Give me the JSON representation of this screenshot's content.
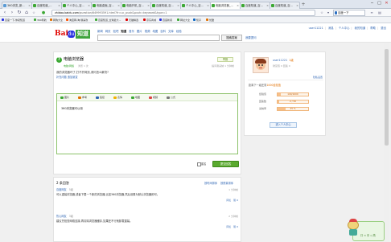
{
  "browser": {
    "tabs": [
      {
        "label": "360浏览_新...",
        "color": "#5b9bd5"
      },
      {
        "label": "百度知道_...",
        "color": "#3ca834"
      },
      {
        "label": "个人中心_百...",
        "color": "#3ca834"
      },
      {
        "label": "电脑桌面_百...",
        "color": "#3ca834"
      },
      {
        "label": "电脑开机_百...",
        "color": "#3ca834"
      },
      {
        "label": "百度知道_百...",
        "color": "#3ca834"
      },
      {
        "label": "个人中心_百...",
        "color": "#3ca834"
      },
      {
        "label": "电脑浏览器_...",
        "color": "#3ca834"
      },
      {
        "label": "百度知道_百...",
        "color": "#3ca834"
      },
      {
        "label": "百度知道_百...",
        "color": "#3ca834"
      }
    ],
    "new_tab": "+",
    "window_controls": [
      "─",
      "□",
      "✕"
    ],
    "url_host": "zhidao.baidu.com",
    "url_path": "/question/649993591.html?fr=uc_push&push=keyword&type=1",
    "search_label": "百度一下",
    "bookmarks": [
      {
        "label": "百度一下,你就知道",
        "color": "#2932e1"
      },
      {
        "label": "360导航",
        "color": "#3ca834"
      },
      {
        "label": "网购大全",
        "color": "#e17000"
      },
      {
        "label": "淘宝网-淘!我喜欢",
        "color": "#ff5000"
      },
      {
        "label": "百度知道_全球最大...",
        "color": "#3ca834"
      },
      {
        "label": "天猫精选",
        "color": "#d00"
      },
      {
        "label": "京东商城",
        "color": "#d00"
      },
      {
        "label": "百度新闻",
        "color": "#2932e1"
      },
      {
        "label": "网址大全",
        "color": "#3ca834"
      },
      {
        "label": "知乎",
        "color": "#0a66c2"
      },
      {
        "label": "优酷",
        "color": "#e17000"
      }
    ]
  },
  "header": {
    "logo_bai": "Bai",
    "logo_paw": "du",
    "logo_zd": "知道",
    "nav": [
      "新闻",
      "网页",
      "贴吧",
      "知道",
      "音乐",
      "图片",
      "视频",
      "地图",
      "百科",
      "文库",
      "经验"
    ],
    "nav_active_index": 3,
    "search_button": "搜索答案",
    "help_link": "我要提问",
    "user_links": [
      "user11221",
      "消息",
      "个人中心",
      "我的知道",
      "帮助",
      "退出"
    ]
  },
  "question": {
    "title": "电脑浏览器",
    "report": "举报",
    "category": "电脑/网络",
    "meta_left": "浏览 1 次",
    "meta_right": "提问者采纳  1 分钟前",
    "body": "我的浏览器坏了,打不开网页,请问怎么解决?",
    "supplement": "补充问题 追加悬赏"
  },
  "editor": {
    "tools": [
      {
        "label": "图片",
        "color": "#3ca834"
      },
      {
        "label": "参考",
        "color": "#e17000"
      },
      {
        "label": "链接",
        "color": "#2d64b3"
      },
      {
        "label": "表情",
        "color": "#f0b400"
      },
      {
        "label": "地图",
        "color": "#3ca834"
      },
      {
        "label": "视频",
        "color": "#d44"
      },
      {
        "label": "公式",
        "color": "#777"
      }
    ],
    "text": "360浏览器可以用"
  },
  "submit": {
    "anonymous_label": "匿名",
    "button_label": "提交回答"
  },
  "answers": {
    "header": "2 条回答",
    "links": [
      "按时间排序",
      "按质量排序"
    ],
    "items": [
      {
        "user": "百度网友",
        "level": "5级",
        "time": "1 分钟前",
        "text": "可以重装浏览器,或者下载一个新的浏览器,比如360浏览器,然后设置为默认浏览器即可。",
        "actions": [
          "评论",
          "赞 0"
        ]
      },
      {
        "user": "热心网友",
        "level": "3级",
        "time": "2 分钟前",
        "text": "建议先检查网络连接,再清除浏览器缓存,如果还不行就卸载重装。",
        "actions": [
          "评论",
          "赞 0"
        ]
      }
    ]
  },
  "sidebar": {
    "username": "user11221",
    "level_badge": "1级",
    "meta": "财富值 0  回答 0",
    "privacy": "隐私设置",
    "exp_prefix": "距离下一级还需",
    "exp_highlight": "1000经验值",
    "stats": [
      {
        "label": "经验值",
        "text": "100/1000",
        "fraction": 0.1
      },
      {
        "label": "回答数",
        "text": "2 / 50",
        "fraction": 0.04
      },
      {
        "label": "采纳率",
        "text": "25 %",
        "fraction": 0.25
      }
    ],
    "enter_button": "进入个人中心"
  },
  "float_widget": {
    "text": "口 < 中 ◇ 简"
  }
}
